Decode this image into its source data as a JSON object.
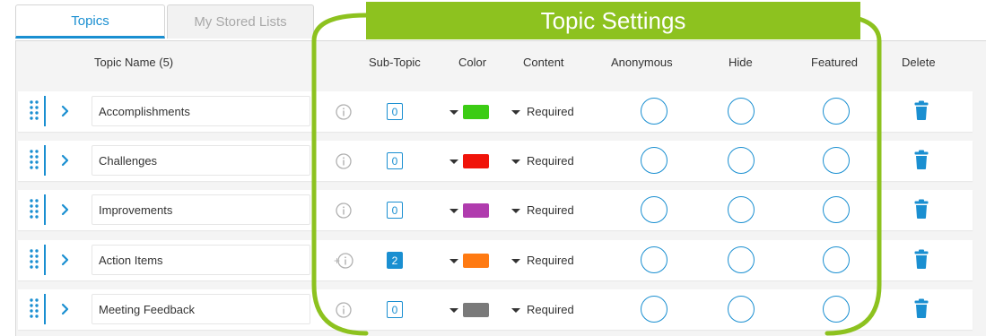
{
  "tabs": {
    "topics": "Topics",
    "stored_lists": "My Stored Lists"
  },
  "callout": {
    "title": "Topic Settings"
  },
  "header": {
    "topic_name": "Topic Name (5)",
    "sub_topic": "Sub-Topic",
    "color": "Color",
    "content": "Content",
    "anonymous": "Anonymous",
    "hide": "Hide",
    "featured": "Featured",
    "delete": "Delete"
  },
  "rows": [
    {
      "name": "Accomplishments",
      "subtopic_count": "0",
      "has_subtopics": false,
      "color": "#3ccc14",
      "content": "Required"
    },
    {
      "name": "Challenges",
      "subtopic_count": "0",
      "has_subtopics": false,
      "color": "#f0140a",
      "content": "Required"
    },
    {
      "name": "Improvements",
      "subtopic_count": "0",
      "has_subtopics": false,
      "color": "#b03cae",
      "content": "Required"
    },
    {
      "name": "Action Items",
      "subtopic_count": "2",
      "has_subtopics": true,
      "color": "#ff7a12",
      "content": "Required"
    },
    {
      "name": "Meeting Feedback",
      "subtopic_count": "0",
      "has_subtopics": false,
      "color": "#7a7a7a",
      "content": "Required"
    }
  ],
  "colors": {
    "accent": "#1a8fd1",
    "callout": "#8dc21f"
  },
  "icons": {
    "drag": "drag-handle-icon",
    "expand": "chevron-right-icon",
    "info": "info-icon",
    "add_info": "add-info-icon",
    "dropdown": "caret-down-icon",
    "delete": "trash-icon"
  }
}
